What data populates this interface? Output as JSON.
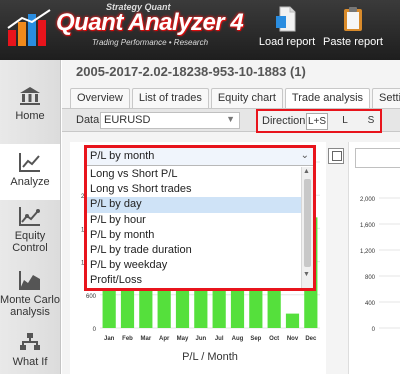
{
  "header": {
    "brand_small": "Strategy Quant",
    "brand_name": "Quant Analyzer 4",
    "tagline": "Trading Performance  •  Research",
    "buttons": [
      {
        "label": "Load report",
        "icon": "document-icon"
      },
      {
        "label": "Paste report",
        "icon": "clipboard-icon"
      }
    ]
  },
  "sidebar": {
    "items": [
      {
        "label": "Home",
        "icon": "bank-icon"
      },
      {
        "label": "Analyze",
        "icon": "line-chart-icon",
        "active": true
      },
      {
        "label": "Equity\nControl",
        "icon": "equity-chart-icon"
      },
      {
        "label": "Monte Carlo\nanalysis",
        "icon": "area-chart-icon"
      },
      {
        "label": "What If",
        "icon": "flow-icon"
      }
    ]
  },
  "main": {
    "title": "2005-2017-2.02-18238-953-10-1883 (1)",
    "tabs": [
      "Overview",
      "List of trades",
      "Equity chart",
      "Trade analysis",
      "Setting"
    ],
    "active_tab": 3,
    "toolbar": {
      "data_label": "Data",
      "data_value": "EURUSD",
      "direction_label": "Direction",
      "direction_options": [
        "L+S",
        "L",
        "S"
      ],
      "direction_selected": "L+S"
    }
  },
  "dropdown": {
    "selected": "P/L by month",
    "options": [
      "Long vs Short P/L",
      "Long vs Short trades",
      "P/L by day",
      "P/L by hour",
      "P/L by month",
      "P/L by trade duration",
      "P/L by weekday",
      "Profit/Loss"
    ],
    "highlighted": "P/L by day"
  },
  "chart_data": {
    "type": "bar",
    "title": "",
    "xlabel": "P/L / Month",
    "ylabel": "",
    "categories": [
      "Jan",
      "Feb",
      "Mar",
      "Apr",
      "May",
      "Jun",
      "Jul",
      "Aug",
      "Sep",
      "Oct",
      "Nov",
      "Dec"
    ],
    "values": [
      1100,
      1080,
      1070,
      1020,
      1100,
      1040,
      740,
      900,
      1100,
      1150,
      260,
      2000
    ],
    "ylim": [
      0,
      3000
    ],
    "yticks": [
      "0",
      "600",
      "1,200",
      "1,800",
      "2,400",
      "3,0"
    ],
    "bar_color": "#55e03c",
    "grid": true
  },
  "right_chart": {
    "yticks": [
      "0",
      "400",
      "800",
      "1,200",
      "1,600",
      "2,000"
    ]
  },
  "colors": {
    "highlight_border": "#e8141c",
    "header_bg": "#2a2a2a",
    "bar": "#55e03c"
  }
}
